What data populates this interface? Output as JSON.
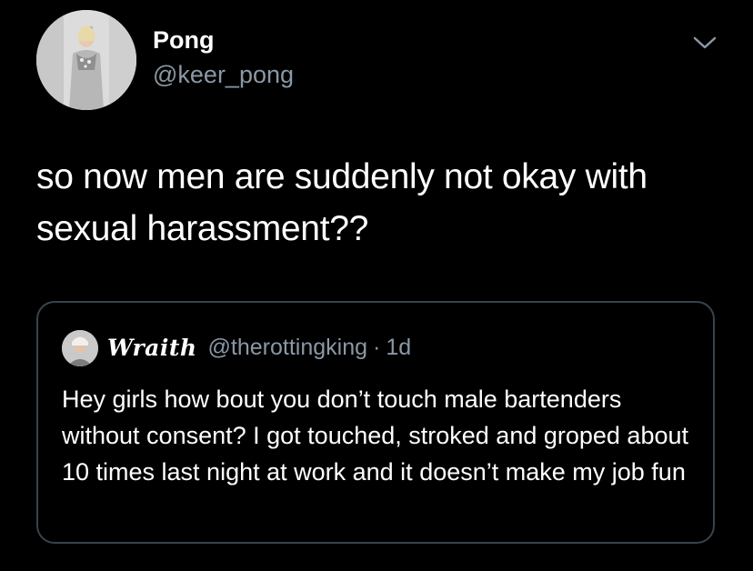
{
  "tweet": {
    "author": {
      "display_name": "Pong",
      "handle": "@keer_pong"
    },
    "text": "so now men are suddenly not okay with sexual harassment??",
    "menu_icon": "chevron-down-icon"
  },
  "quoted_tweet": {
    "display_name": "Wraith",
    "handle": "@therottingking",
    "separator": "·",
    "time": "1d",
    "text": "Hey girls how bout you don’t touch male bartenders without consent? I got touched, stroked and groped about 10 times last night at work and it doesn’t make my job fun"
  },
  "colors": {
    "background": "#000000",
    "primary_text": "#ffffff",
    "secondary_text": "#8b98a5",
    "card_border": "#38444d"
  }
}
